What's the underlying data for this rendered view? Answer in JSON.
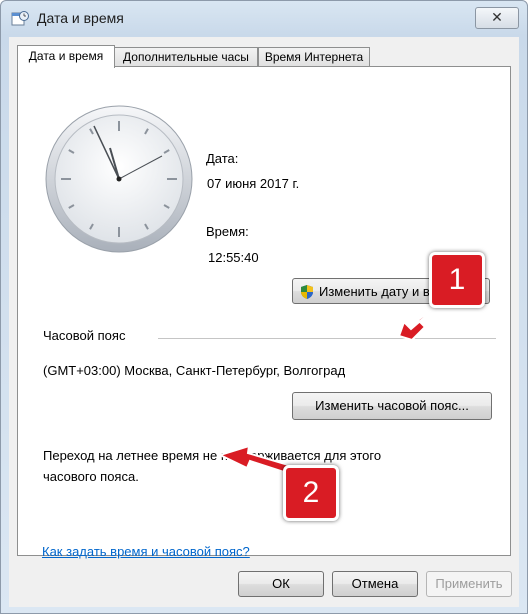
{
  "window": {
    "title": "Дата и время"
  },
  "tabs": [
    {
      "label": "Дата и время",
      "active": true
    },
    {
      "label": "Дополнительные часы",
      "active": false
    },
    {
      "label": "Время Интернета",
      "active": false
    }
  ],
  "date_time": {
    "date_label": "Дата:",
    "date_value": "07 июня 2017 г.",
    "time_label": "Время:",
    "time_value": "12:55:40",
    "change_datetime_button": "Изменить дату и время..."
  },
  "timezone": {
    "section_label": "Часовой пояс",
    "value": "(GMT+03:00) Москва, Санкт-Петербург, Волгоград",
    "change_button": "Изменить часовой пояс..."
  },
  "dst_notice": {
    "line1": "Переход на летнее время не поддерживается для этого",
    "line2": "часового пояса."
  },
  "help_link": "Как задать время и часовой пояс?",
  "footer": {
    "ok": "ОК",
    "cancel": "Отмена",
    "apply": "Применить"
  },
  "annotations": {
    "callout1": "1",
    "callout2": "2"
  },
  "colors": {
    "annotation_red": "#d91c24",
    "link_blue": "#0066cc"
  },
  "icons": [
    "calendar-clock-icon",
    "close-icon",
    "uac-shield-icon"
  ]
}
